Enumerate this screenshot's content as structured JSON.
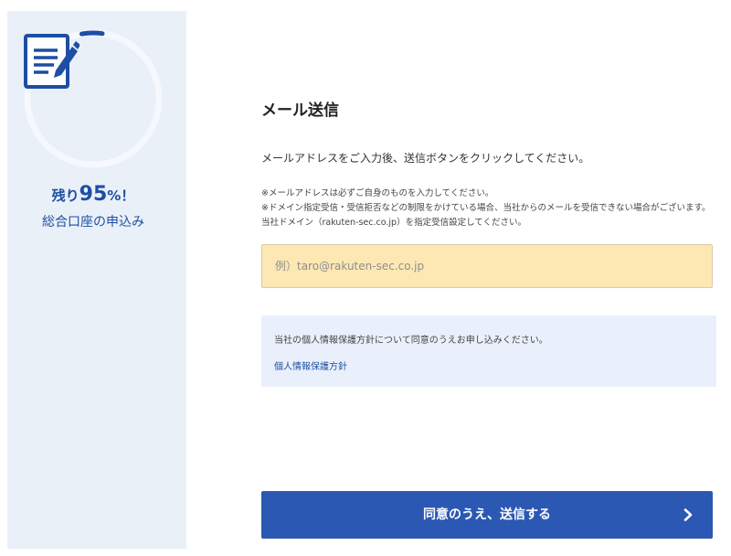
{
  "progress": {
    "remaining_prefix": "残り",
    "remaining_number": "95",
    "remaining_suffix": "%！",
    "remaining_fraction": 0.95,
    "completed_fraction": 0.05
  },
  "app_title": "総合口座の申込み",
  "form": {
    "title": "メール送信",
    "instruction": "メールアドレスをご入力後、送信ボタンをクリックしてください。",
    "note_1": "※メールアドレスは必ずご自身のものを入力してください。",
    "note_2": "※ドメイン指定受信・受信拒否などの制限をかけている場合、当社からのメールを受信できない場合がございます。当社ドメイン（rakuten-sec.co.jp）を指定受信設定してください。",
    "email_value": "",
    "email_placeholder": "例）taro@rakuten-sec.co.jp"
  },
  "policy": {
    "text": "当社の個人情報保護方針について同意のうえお申し込みください。",
    "link_label": "個人情報保護方針"
  },
  "submit_label": "同意のうえ、送信する",
  "icons": {
    "progress": "document-edit-icon",
    "submit": "chevron-right-icon"
  },
  "colors": {
    "accent": "#2b58b3",
    "brand_text": "#1d4ea3",
    "sidebar_bg": "#eaf0f8",
    "input_bg": "#fde8b4",
    "policy_bg": "#eaf0fb"
  }
}
